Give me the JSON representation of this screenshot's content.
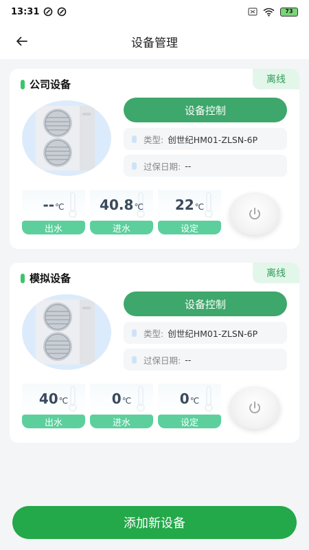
{
  "status_bar": {
    "time": "13:31",
    "battery": "73"
  },
  "nav": {
    "title": "设备管理"
  },
  "devices": [
    {
      "name": "公司设备",
      "status": "离线",
      "control_label": "设备控制",
      "type_label": "类型:",
      "type_value": "创世纪HM01-ZLSN-6P",
      "warranty_label": "过保日期:",
      "warranty_value": "--",
      "metrics": [
        {
          "value": "--",
          "unit": "℃",
          "label": "出水"
        },
        {
          "value": "40.8",
          "unit": "℃",
          "label": "进水"
        },
        {
          "value": "22",
          "unit": "℃",
          "label": "设定"
        }
      ]
    },
    {
      "name": "模拟设备",
      "status": "离线",
      "control_label": "设备控制",
      "type_label": "类型:",
      "type_value": "创世纪HM01-ZLSN-6P",
      "warranty_label": "过保日期:",
      "warranty_value": "--",
      "metrics": [
        {
          "value": "40",
          "unit": "℃",
          "label": "出水"
        },
        {
          "value": "0",
          "unit": "℃",
          "label": "进水"
        },
        {
          "value": "0",
          "unit": "℃",
          "label": "设定"
        }
      ]
    }
  ],
  "add_button": {
    "label": "添加新设备"
  },
  "colors": {
    "primary": "#23a84a",
    "control_button": "#3ea76b",
    "metric_label": "#5ccf9d",
    "offline_tag_bg": "#e3f6ea",
    "offline_tag_text": "#2e9c55"
  }
}
